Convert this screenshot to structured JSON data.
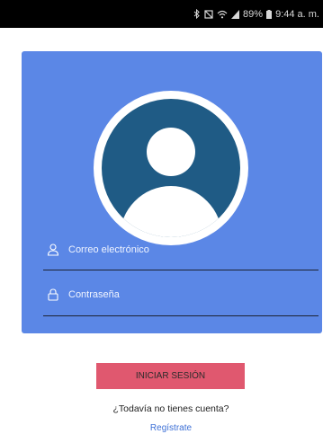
{
  "status_bar": {
    "battery": "89%",
    "time": "9:44 a. m."
  },
  "login_card": {
    "email_placeholder": "Correo electrónico",
    "password_placeholder": "Contraseña"
  },
  "actions": {
    "login_label": "INICIAR SESIÓN",
    "no_account_text": "¿Todavía no tienes cuenta?",
    "register_label": "Regístrate"
  },
  "colors": {
    "card_background": "#5b87e6",
    "avatar_dark": "#1f5b85",
    "login_button": "#e0586f",
    "link": "#3c6fd6"
  }
}
